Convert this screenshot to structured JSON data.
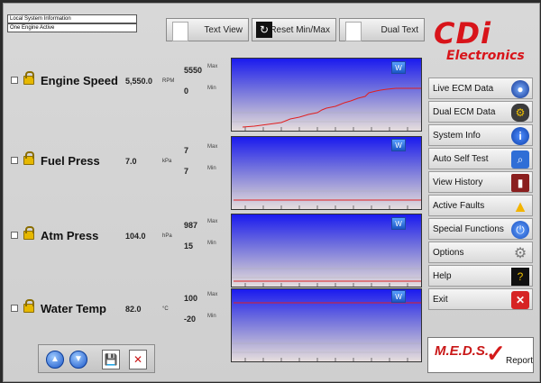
{
  "info": {
    "line1": "Local System Information",
    "line2": "One Engine Active"
  },
  "toolbar": {
    "text_view": "Text View",
    "reset": "Reset Min/Max",
    "dual_text": "Dual Text"
  },
  "gauges": [
    {
      "label": "Engine Speed",
      "value": "5,550.0",
      "unit": "RPM",
      "max": "5550",
      "min": "0",
      "max_tag": "Max",
      "min_tag": "Min"
    },
    {
      "label": "Fuel Press",
      "value": "7.0",
      "unit": "kPa",
      "max": "7",
      "min": "7",
      "max_tag": "Max",
      "min_tag": "Min"
    },
    {
      "label": "Atm Press",
      "value": "104.0",
      "unit": "hPa",
      "max": "987",
      "min": "15",
      "max_tag": "Max",
      "min_tag": "Min"
    },
    {
      "label": "Water Temp",
      "value": "82.0",
      "unit": "°C",
      "max": "100",
      "min": "-20",
      "max_tag": "Max",
      "min_tag": "Min"
    }
  ],
  "sidebar": {
    "logo_main": "CDi",
    "logo_sub": "Electronics",
    "items": [
      {
        "label": "Live ECM Data",
        "icon": "globe-icon"
      },
      {
        "label": "Dual ECM Data",
        "icon": "engine-icon"
      },
      {
        "label": "System Info",
        "icon": "info-icon"
      },
      {
        "label": "Auto Self Test",
        "icon": "magnifier-icon"
      },
      {
        "label": "View History",
        "icon": "book-icon"
      },
      {
        "label": "Active Faults",
        "icon": "warning-icon"
      },
      {
        "label": "Special Functions",
        "icon": "power-icon"
      },
      {
        "label": "Options",
        "icon": "gears-icon"
      },
      {
        "label": "Help",
        "icon": "help-icon"
      },
      {
        "label": "Exit",
        "icon": "close-icon"
      }
    ],
    "meds_main": "M.E.D.S.",
    "meds_sub": "Report"
  },
  "colors": {
    "accent": "#d8141a",
    "chart_line": "#e02020"
  }
}
